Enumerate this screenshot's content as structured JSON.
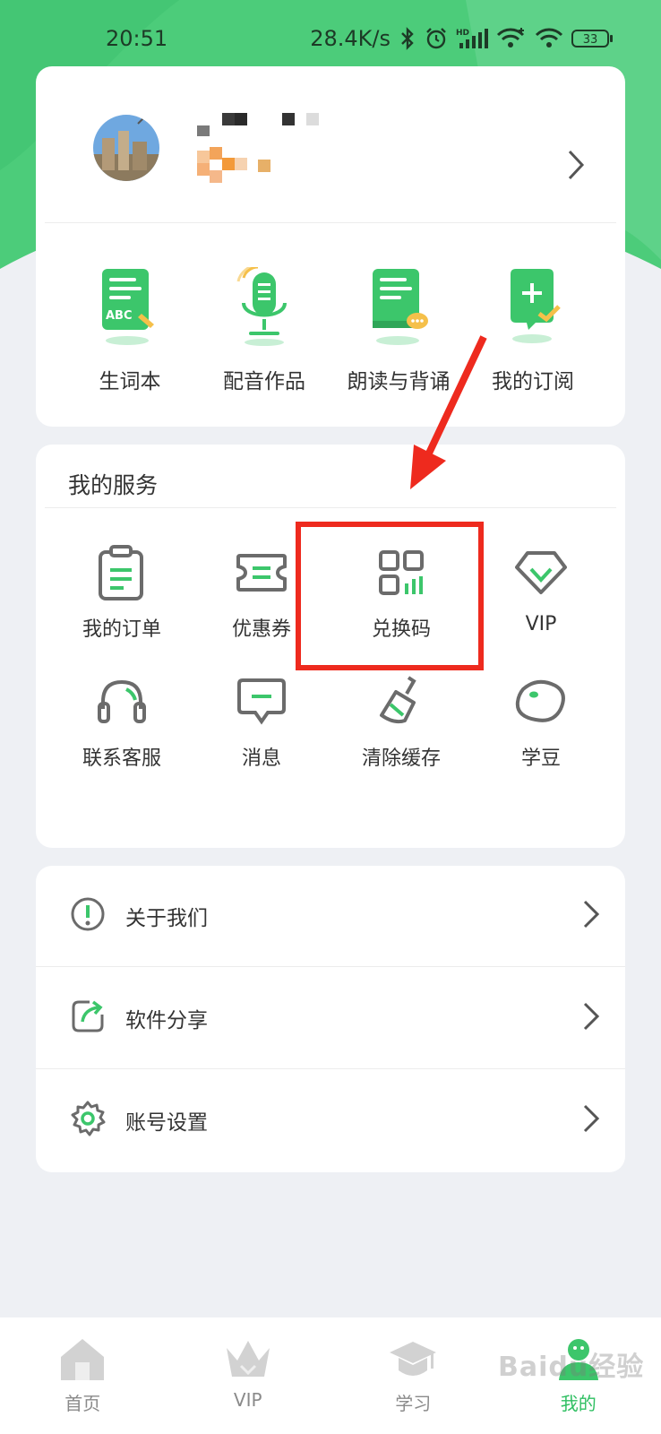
{
  "status_bar": {
    "time": "20:51",
    "net_speed": "28.4K/s",
    "battery": "33",
    "icons": [
      "bluetooth-icon",
      "alarm-icon",
      "hd-signal-icon",
      "wifi-plus-icon",
      "wifi-icon",
      "battery-icon"
    ]
  },
  "profile": {
    "avatar": "avatar-photo",
    "name_redacted": true
  },
  "features": [
    {
      "label": "生词本",
      "icon": "vocab-book-icon"
    },
    {
      "label": "配音作品",
      "icon": "microphone-icon"
    },
    {
      "label": "朗读与背诵",
      "icon": "reading-book-icon"
    },
    {
      "label": "我的订阅",
      "icon": "subscribe-icon"
    }
  ],
  "services": {
    "title": "我的服务",
    "items": [
      {
        "label": "我的订单",
        "icon": "clipboard-icon"
      },
      {
        "label": "优惠券",
        "icon": "coupon-icon"
      },
      {
        "label": "兑换码",
        "icon": "qr-code-icon"
      },
      {
        "label": "VIP",
        "icon": "diamond-icon"
      },
      {
        "label": "联系客服",
        "icon": "headset-icon"
      },
      {
        "label": "消息",
        "icon": "message-icon"
      },
      {
        "label": "清除缓存",
        "icon": "brush-icon"
      },
      {
        "label": "学豆",
        "icon": "bean-icon"
      }
    ]
  },
  "menu": [
    {
      "label": "关于我们",
      "icon": "info-icon"
    },
    {
      "label": "软件分享",
      "icon": "share-icon"
    },
    {
      "label": "账号设置",
      "icon": "gear-icon"
    }
  ],
  "bottom_nav": [
    {
      "label": "首页",
      "icon": "home-icon",
      "active": false
    },
    {
      "label": "VIP",
      "icon": "crown-icon",
      "active": false
    },
    {
      "label": "学习",
      "icon": "graduation-cap-icon",
      "active": false
    },
    {
      "label": "我的",
      "icon": "profile-icon",
      "active": true
    }
  ],
  "watermark": "Baidu经验",
  "colors": {
    "brand_green": "#3cc66b",
    "annotation_red": "#ee2a1e",
    "icon_gray": "#6b6b6b"
  }
}
